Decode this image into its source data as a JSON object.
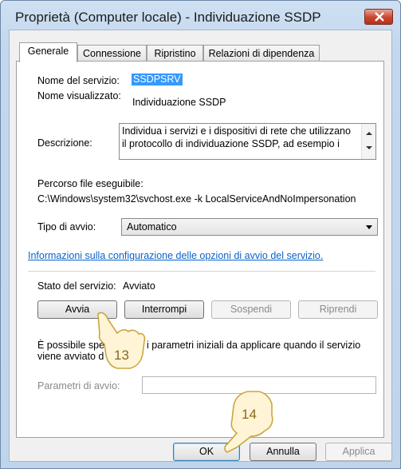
{
  "window": {
    "title": "Proprietà (Computer locale) - Individuazione SSDP"
  },
  "tabs": [
    {
      "label": "Generale",
      "active": true
    },
    {
      "label": "Connessione",
      "active": false
    },
    {
      "label": "Ripristino",
      "active": false
    },
    {
      "label": "Relazioni di dipendenza",
      "active": false
    }
  ],
  "general": {
    "service_name_label": "Nome del servizio:",
    "service_name_value": "SSDPSRV",
    "display_name_label": "Nome visualizzato:",
    "display_name_value": "Individuazione SSDP",
    "description_label": "Descrizione:",
    "description_line1": "Individua i servizi e i dispositivi di rete che utilizzano",
    "description_line2": "il protocollo di individuazione SSDP, ad esempio i",
    "exec_path_label": "Percorso file eseguibile:",
    "exec_path_value": "C:\\Windows\\system32\\svchost.exe -k LocalServiceAndNoImpersonation",
    "startup_type_label": "Tipo di avvio:",
    "startup_type_value": "Automatico",
    "config_link": "Informazioni sulla configurazione delle opzioni di avvio del servizio.",
    "status_label": "Stato del servizio:",
    "status_value": "Avviato",
    "buttons": {
      "start": "Avvia",
      "stop": "Interrompi",
      "pause": "Sospendi",
      "resume": "Riprendi"
    },
    "params_hint_line1": "È possibile spec",
    "params_hint_line1b": "i parametri iniziali da applicare quando il servizio",
    "params_hint_line2": "viene avviato d",
    "start_params_label": "Parametri di avvio:"
  },
  "footer": {
    "ok": "OK",
    "cancel": "Annulla",
    "apply": "Applica"
  },
  "callouts": [
    {
      "number": "13",
      "icon": "hand-pointer-icon"
    },
    {
      "number": "14",
      "icon": "hand-pointer-icon"
    }
  ],
  "colors": {
    "selection": "#3399ff",
    "link": "#0a63c9",
    "close_button": "#c8452e",
    "callout_fill": "#fff4d6",
    "callout_stroke": "#c9a640"
  }
}
